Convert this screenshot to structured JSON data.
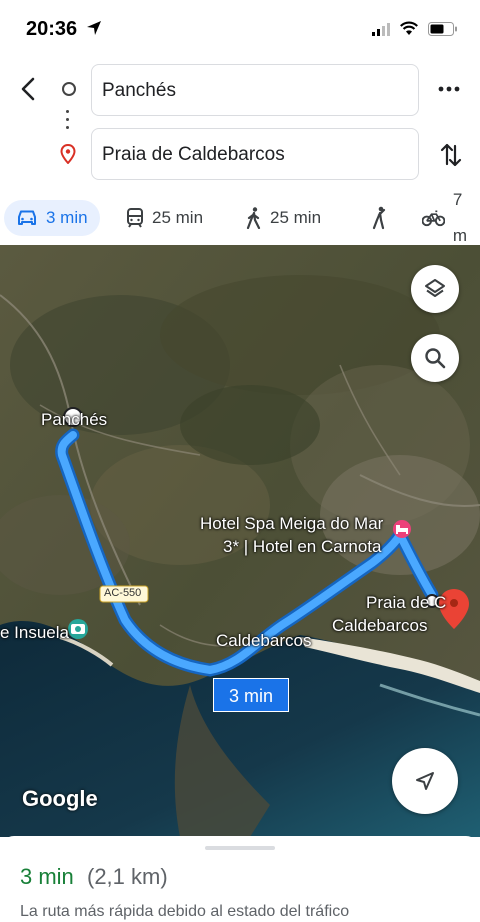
{
  "status_bar": {
    "time": "20:36"
  },
  "directions": {
    "origin": "Panchés",
    "destination": "Praia de Caldebarcos"
  },
  "modes": [
    {
      "icon": "car-icon",
      "label": "3 min",
      "active": true
    },
    {
      "icon": "transit-icon",
      "label": "25 min"
    },
    {
      "icon": "walk-icon",
      "label": "25 min"
    },
    {
      "icon": "rideshare-icon",
      "label": ""
    },
    {
      "icon": "bike-icon",
      "label": "7 m"
    }
  ],
  "map": {
    "labels": {
      "origin": "Panchés",
      "hotel_line1": "Hotel Spa Meiga do Mar",
      "hotel_line2": "3* | Hotel en Carnota",
      "road": "AC-550",
      "insuela": "e Insuela",
      "caldebarcos": "Caldebarcos",
      "dest_line1": "Praia de C",
      "dest_line2": "Caldebarcos"
    },
    "route_time": "3 min",
    "attribution": "Google",
    "route_color": "#4aa8ff"
  },
  "summary": {
    "duration": "3 min",
    "distance": "(2,1 km)",
    "note": "La ruta más rápida debido al estado del tráfico"
  }
}
